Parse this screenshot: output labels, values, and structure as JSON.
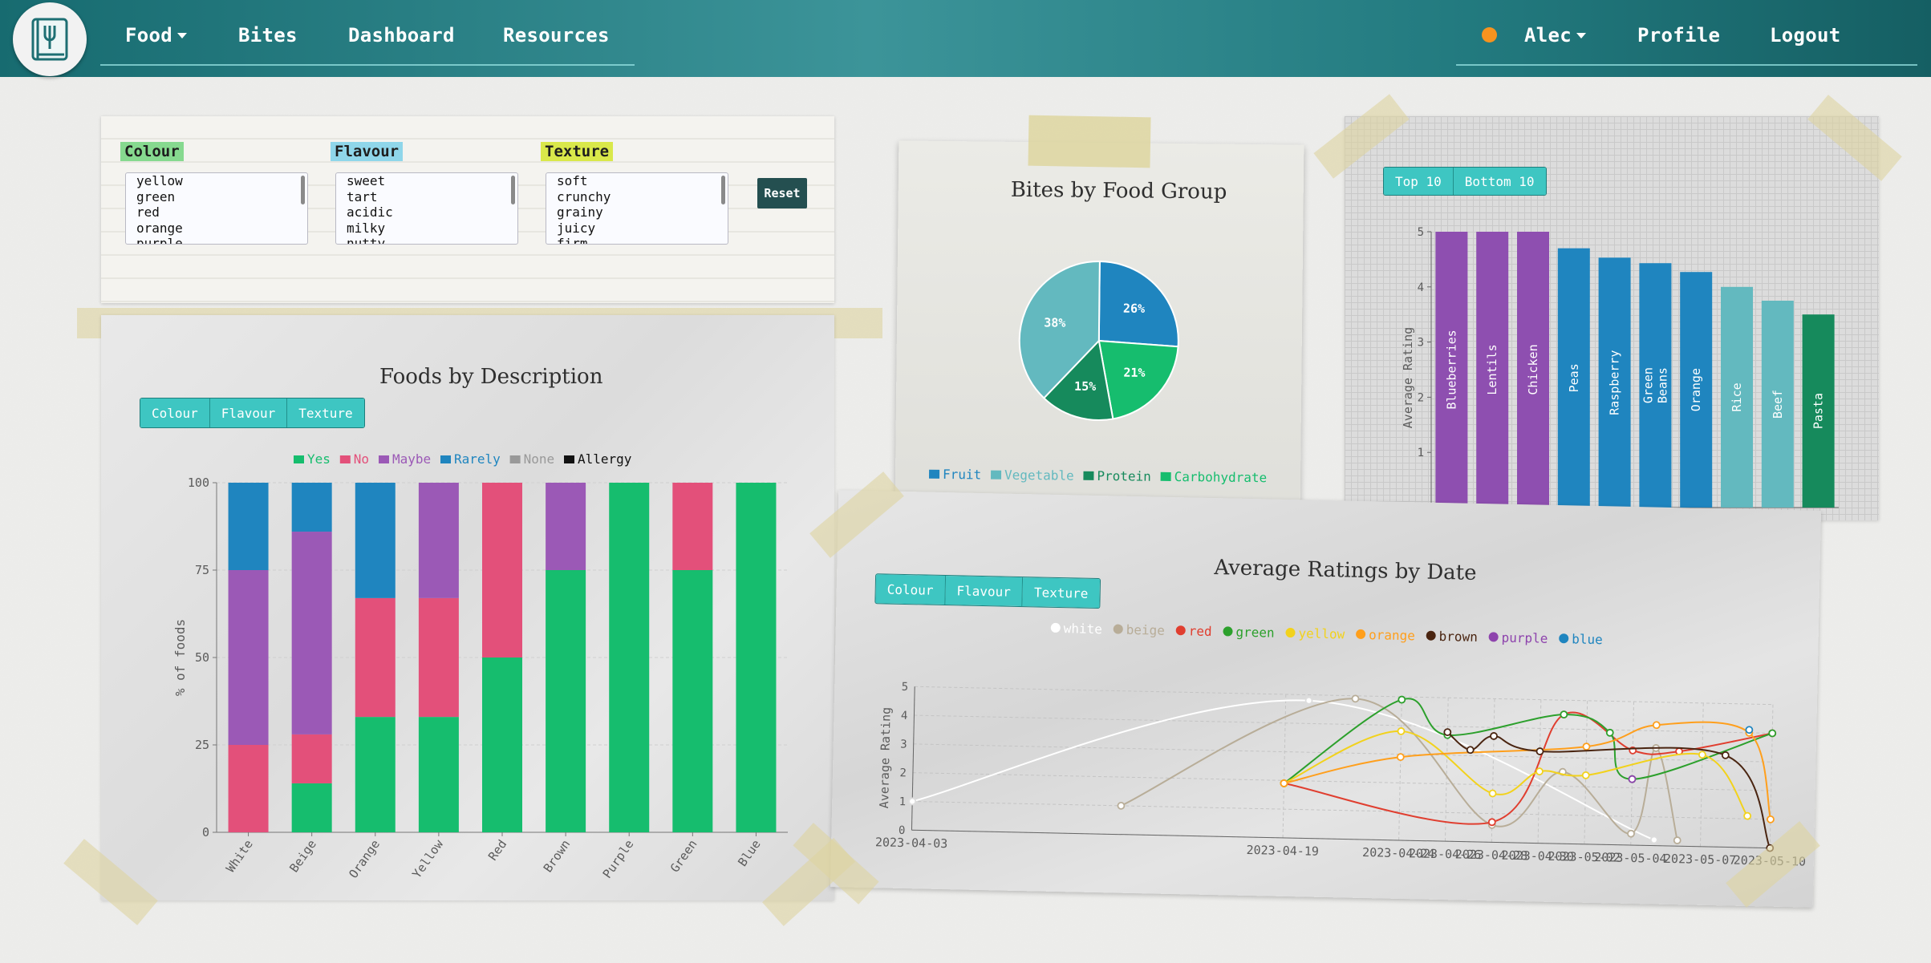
{
  "nav": {
    "left_items": [
      {
        "label": "Food",
        "dropdown": true
      },
      {
        "label": "Bites",
        "dropdown": false
      },
      {
        "label": "Dashboard",
        "dropdown": false
      },
      {
        "label": "Resources",
        "dropdown": false
      }
    ],
    "user": {
      "label": "Alec",
      "status_color": "#f7931e"
    },
    "right_items": [
      {
        "label": "Profile"
      },
      {
        "label": "Logout"
      }
    ],
    "logo_icon": "fork-book-icon"
  },
  "filters": {
    "groups": [
      {
        "label": "Colour",
        "label_color": "#86d98f",
        "options": [
          "yellow",
          "green",
          "red",
          "orange",
          "purple"
        ]
      },
      {
        "label": "Flavour",
        "label_color": "#8fd6ea",
        "options": [
          "sweet",
          "tart",
          "acidic",
          "milky",
          "nutty"
        ]
      },
      {
        "label": "Texture",
        "label_color": "#d9e84a",
        "options": [
          "soft",
          "crunchy",
          "grainy",
          "juicy",
          "firm"
        ]
      }
    ],
    "reset_label": "Reset"
  },
  "foods_by_description": {
    "title": "Foods by Description",
    "tabs": [
      "Colour",
      "Flavour",
      "Texture"
    ],
    "chart_data": {
      "type": "bar",
      "stacked": true,
      "categories": [
        "White",
        "Beige",
        "Orange",
        "Yellow",
        "Red",
        "Brown",
        "Purple",
        "Green",
        "Blue"
      ],
      "series": [
        {
          "name": "Yes",
          "color": "#16bd6e",
          "values": [
            0,
            14,
            33,
            33,
            50,
            75,
            100,
            75,
            100
          ]
        },
        {
          "name": "No",
          "color": "#e3507a",
          "values": [
            25,
            14,
            34,
            34,
            50,
            0,
            0,
            25,
            0
          ]
        },
        {
          "name": "Maybe",
          "color": "#9b59b6",
          "values": [
            50,
            58,
            0,
            33,
            0,
            25,
            0,
            0,
            0
          ]
        },
        {
          "name": "Rarely",
          "color": "#1f85bf",
          "values": [
            25,
            14,
            33,
            0,
            0,
            0,
            0,
            0,
            0
          ]
        },
        {
          "name": "None",
          "color": "#999999",
          "values": [
            0,
            0,
            0,
            0,
            0,
            0,
            0,
            0,
            0
          ]
        },
        {
          "name": "Allergy",
          "color": "#111111",
          "values": [
            0,
            0,
            0,
            0,
            0,
            0,
            0,
            0,
            0
          ]
        }
      ],
      "ylabel": "% of foods",
      "ylim": [
        0,
        100
      ],
      "yticks": [
        0,
        25,
        50,
        75,
        100
      ],
      "legend": "top"
    }
  },
  "bites_by_food_group": {
    "title": "Bites by Food Group",
    "chart_data": {
      "type": "pie",
      "slices": [
        {
          "label": "Fruit",
          "value": 26,
          "display": "26%",
          "color": "#1f85bf"
        },
        {
          "label": "Carbohydrate",
          "value": 21,
          "display": "21%",
          "color": "#16bd6e"
        },
        {
          "label": "Protein",
          "value": 15,
          "display": "15%",
          "color": "#168a5c"
        },
        {
          "label": "Vegetable",
          "value": 38,
          "display": "38%",
          "color": "#63b9bf"
        }
      ],
      "legend_order": [
        "Fruit",
        "Vegetable",
        "Protein",
        "Carbohydrate"
      ],
      "legend": "bottom"
    }
  },
  "top_foods": {
    "tabs": [
      "Top 10",
      "Bottom 10"
    ],
    "chart_data": {
      "type": "bar",
      "categories": [
        "Blueberries",
        "Lentils",
        "Chicken",
        "Peas",
        "Raspberry",
        "Green Beans",
        "Orange",
        "Rice",
        "Beef",
        "Pasta"
      ],
      "values": [
        5,
        5,
        5,
        4.7,
        4.53,
        4.43,
        4.27,
        4,
        3.75,
        3.5
      ],
      "colors": [
        "#8e4fb0",
        "#8e4fb0",
        "#8e4fb0",
        "#1f85bf",
        "#1f85bf",
        "#1f85bf",
        "#1f85bf",
        "#63b9bf",
        "#63b9bf",
        "#168a5c"
      ],
      "ylabel": "Average Rating",
      "ylim": [
        0,
        5
      ],
      "yticks": [
        0,
        1,
        2,
        3,
        4,
        5
      ]
    }
  },
  "average_ratings": {
    "title": "Average Ratings by Date",
    "tabs": [
      "Colour",
      "Flavour",
      "Texture"
    ],
    "chart_data": {
      "type": "line",
      "x": [
        "2023-04-03",
        "2023-04-19",
        "2023-04-24",
        "2023-04-26",
        "2023-04-28",
        "2023-04-30",
        "2023-05-02",
        "2023-05-04",
        "2023-05-07",
        "2023-05-10"
      ],
      "ylabel": "Average Rating",
      "ylim": [
        0,
        5
      ],
      "yticks": [
        0,
        1,
        2,
        3,
        4,
        5
      ],
      "legend": "top",
      "series": [
        {
          "name": "white",
          "color": "#ffffff",
          "points": [
            [
              "2023-04-03",
              1
            ],
            [
              "2023-04-20",
              4.8
            ],
            [
              "2023-05-05",
              0.2
            ]
          ]
        },
        {
          "name": "beige",
          "color": "#b8ad98",
          "points": [
            [
              "2023-04-12",
              1
            ],
            [
              "2023-04-22",
              4.9
            ],
            [
              "2023-04-28",
              0.6
            ],
            [
              "2023-05-01",
              2.5
            ],
            [
              "2023-05-04",
              0.4
            ],
            [
              "2023-05-05",
              3.4
            ],
            [
              "2023-05-06",
              0.2
            ]
          ]
        },
        {
          "name": "red",
          "color": "#e03e2f",
          "points": [
            [
              "2023-04-19",
              1.9
            ],
            [
              "2023-04-28",
              0.7
            ],
            [
              "2023-05-01",
              4.5
            ],
            [
              "2023-05-04",
              3.3
            ],
            [
              "2023-05-06",
              3.3
            ],
            [
              "2023-05-10",
              4
            ]
          ]
        },
        {
          "name": "green",
          "color": "#2ca02c",
          "points": [
            [
              "2023-04-19",
              1.9
            ],
            [
              "2023-04-24",
              4.9
            ],
            [
              "2023-04-26",
              3.7
            ],
            [
              "2023-05-01",
              4.5
            ],
            [
              "2023-05-03",
              3.9
            ],
            [
              "2023-05-04",
              2.3
            ],
            [
              "2023-05-10",
              4
            ]
          ]
        },
        {
          "name": "yellow",
          "color": "#f2d21c",
          "points": [
            [
              "2023-04-19",
              1.9
            ],
            [
              "2023-04-24",
              3.8
            ],
            [
              "2023-04-28",
              1.7
            ],
            [
              "2023-04-30",
              2.5
            ],
            [
              "2023-05-02",
              2.4
            ],
            [
              "2023-05-07",
              3.2
            ],
            [
              "2023-05-09",
              1.1
            ]
          ]
        },
        {
          "name": "orange",
          "color": "#ff9f1c",
          "points": [
            [
              "2023-04-19",
              1.9
            ],
            [
              "2023-04-24",
              2.9
            ],
            [
              "2023-05-02",
              3.4
            ],
            [
              "2023-05-05",
              4.2
            ],
            [
              "2023-05-09",
              4
            ],
            [
              "2023-05-10",
              1
            ]
          ]
        },
        {
          "name": "brown",
          "color": "#4a2511",
          "points": [
            [
              "2023-04-26",
              3.8
            ],
            [
              "2023-04-27",
              3.2
            ],
            [
              "2023-04-28",
              3.7
            ],
            [
              "2023-04-30",
              3.2
            ],
            [
              "2023-05-08",
              3.2
            ],
            [
              "2023-05-10",
              0
            ]
          ]
        },
        {
          "name": "purple",
          "color": "#8e44ad",
          "points": [
            [
              "2023-05-04",
              2.3
            ]
          ]
        },
        {
          "name": "blue",
          "color": "#1f85bf",
          "points": [
            [
              "2023-05-09",
              4.1
            ]
          ]
        }
      ]
    }
  }
}
